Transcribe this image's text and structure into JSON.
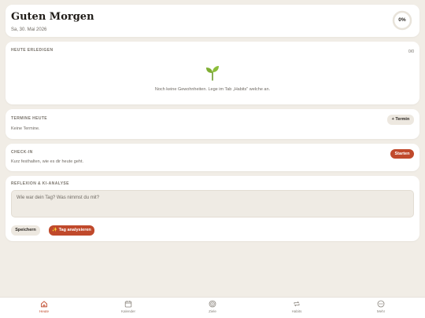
{
  "header": {
    "greeting": "Guten Morgen",
    "date": "Sa, 30. Mai 2026",
    "progress_label": "0%",
    "progress_value": 0
  },
  "habits": {
    "title": "HEUTE ERLEDIGEN",
    "counter": "0/0",
    "empty_text": "Noch keine Gewohnheiten. Lege im Tab „Habits\" welche an.",
    "icon": "sprout-icon"
  },
  "termine": {
    "title": "TERMINE HEUTE",
    "empty_text": "Keine Termine.",
    "add_button": "+ Termin"
  },
  "checkin": {
    "title": "CHECK-IN",
    "text": "Kurz festhalten, wie es dir heute geht.",
    "start_button": "Starten"
  },
  "reflexion": {
    "title": "REFLEXION & KI-ANALYSE",
    "placeholder": "Wie war dein Tag? Was nimmst du mit?",
    "save_button": "Speichern",
    "analyze_button": "✨ Tag analysieren"
  },
  "nav": {
    "items": [
      {
        "label": "Heute",
        "icon": "home-icon",
        "active": true
      },
      {
        "label": "Kalender",
        "icon": "calendar-icon",
        "active": false
      },
      {
        "label": "Ziele",
        "icon": "target-icon",
        "active": false
      },
      {
        "label": "Habits",
        "icon": "repeat-icon",
        "active": false
      },
      {
        "label": "Mehr",
        "icon": "more-icon",
        "active": false
      }
    ]
  },
  "colors": {
    "background": "#f1ede6",
    "card": "#ffffff",
    "accent": "#c0492b",
    "muted_button": "#ede8e0",
    "sprout": "#6a9a2a"
  }
}
